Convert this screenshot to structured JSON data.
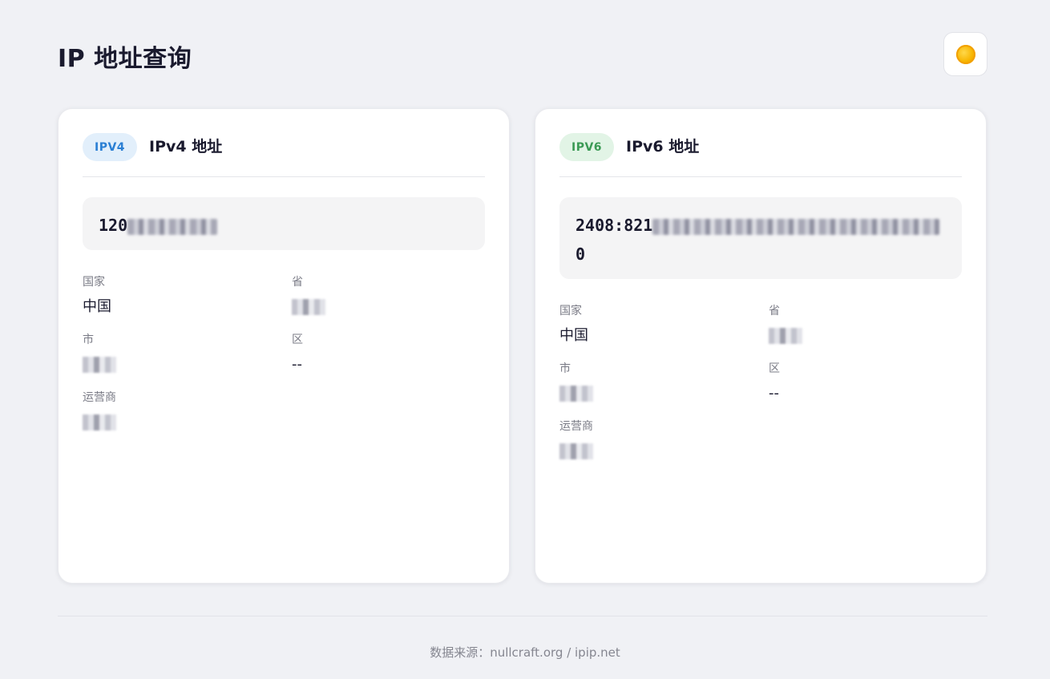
{
  "header": {
    "title": "IP 地址查询",
    "theme_icon": "sun-icon"
  },
  "ipv4": {
    "badge": "IPV4",
    "title": "IPv4 地址",
    "address_visible": "120",
    "fields": {
      "country_label": "国家",
      "country_value": "中国",
      "province_label": "省",
      "province_value": "",
      "city_label": "市",
      "city_value": "",
      "district_label": "区",
      "district_value": "--",
      "isp_label": "运营商",
      "isp_value": ""
    },
    "badge_color": "#2a7fd4"
  },
  "ipv6": {
    "badge": "IPV6",
    "title": "IPv6 地址",
    "address_visible_line1": "2408:821",
    "address_visible_line2": "0",
    "fields": {
      "country_label": "国家",
      "country_value": "中国",
      "province_label": "省",
      "province_value": "",
      "city_label": "市",
      "city_value": "",
      "district_label": "区",
      "district_value": "--",
      "isp_label": "运营商",
      "isp_value": ""
    },
    "badge_color": "#3b9a55"
  },
  "footer": {
    "source": "数据来源：nullcraft.org / ipip.net"
  }
}
